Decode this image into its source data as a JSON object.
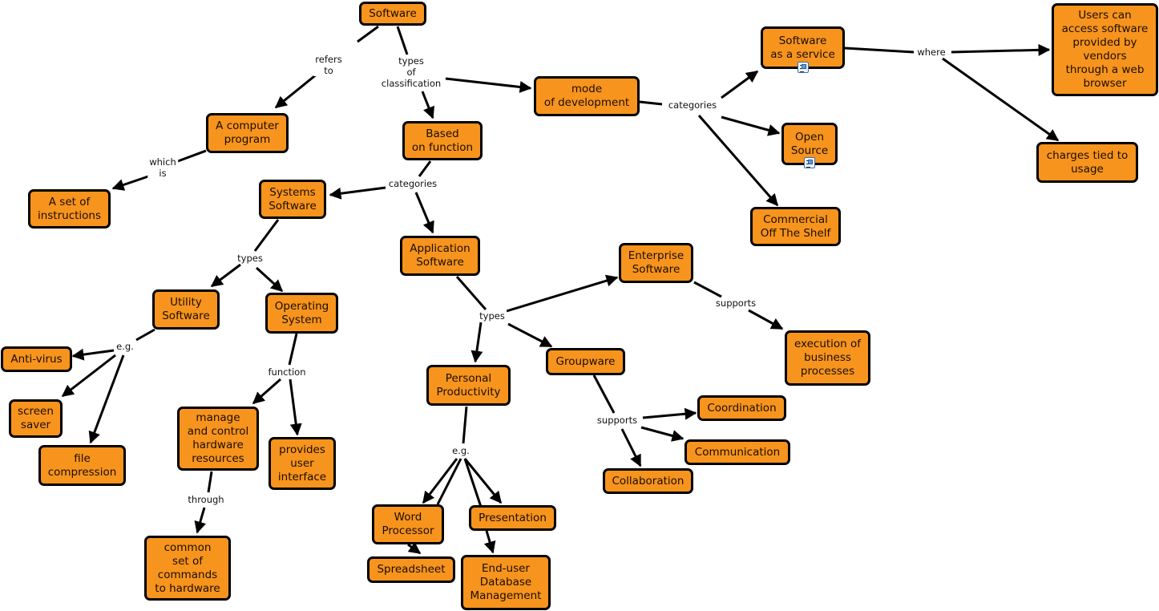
{
  "colors": {
    "concept_fill": "#F7941D",
    "concept_border": "#000000",
    "link_line": "#000000",
    "background": "#FFFFFF"
  },
  "concepts": {
    "software": "Software",
    "computer_program": "A computer\nprogram",
    "set_of_instructions": "A set of\ninstructions",
    "based_on_function": "Based\non function",
    "mode_of_development": "mode\nof development",
    "saas": "Software\nas a service",
    "open_source": "Open\nSource",
    "cots": "Commercial\nOff The Shelf",
    "users_access": "Users can\naccess software\nprovided by\nvendors\nthrough a web\nbrowser",
    "charges_usage": "charges tied to\nusage",
    "systems_software": "Systems\nSoftware",
    "application_software": "Application\nSoftware",
    "utility_software": "Utility\nSoftware",
    "operating_system": "Operating\nSystem",
    "anti_virus": "Anti-virus",
    "screen_saver": "screen\nsaver",
    "file_compression": "file\ncompression",
    "manage_hardware": "manage\nand control\nhardware\nresources",
    "user_interface": "provides\nuser\ninterface",
    "common_commands": "common\nset of\ncommands\nto hardware",
    "enterprise_software": "Enterprise\nSoftware",
    "business_processes": "execution of\nbusiness\nprocesses",
    "groupware": "Groupware",
    "personal_productivity": "Personal\nProductivity",
    "coordination": "Coordination",
    "communication": "Communication",
    "collaboration": "Collaboration",
    "word_processor": "Word\nProcessor",
    "presentation": "Presentation",
    "spreadsheet": "Spreadsheet",
    "database_mgmt": "End-user\nDatabase\nManagement"
  },
  "links": {
    "refers_to": "refers\nto",
    "types_of_classification": "types\nof\nclassification",
    "which_is": "which\nis",
    "categories_dev": "categories",
    "where": "where",
    "categories_func": "categories",
    "types_sys": "types",
    "types_app": "types",
    "eg_utility": "e.g.",
    "function": "function",
    "through": "through",
    "supports_enterprise": "supports",
    "supports_groupware": "supports",
    "eg_personal": "e.g."
  },
  "attachments": {
    "saas": "document-icon",
    "open_source": "document-icon"
  }
}
